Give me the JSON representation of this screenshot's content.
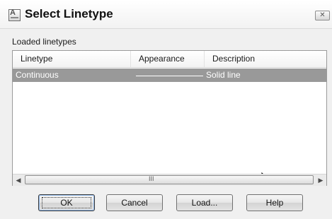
{
  "window": {
    "title": "Select Linetype",
    "close_glyph": "✕"
  },
  "section_label": "Loaded linetypes",
  "table": {
    "columns": [
      "Linetype",
      "Appearance",
      "Description"
    ],
    "rows": [
      {
        "linetype": "Continuous",
        "appearance": "solid-line-sample",
        "description": "Solid line",
        "selected": true
      }
    ]
  },
  "scrollbar": {
    "left_arrow": "◀",
    "right_arrow": "▶",
    "grip": "III"
  },
  "buttons": {
    "ok": "OK",
    "cancel": "Cancel",
    "load": "Load...",
    "help": "Help"
  },
  "colors": {
    "selection": "#999999",
    "window_bg": "#f0f0f0"
  }
}
